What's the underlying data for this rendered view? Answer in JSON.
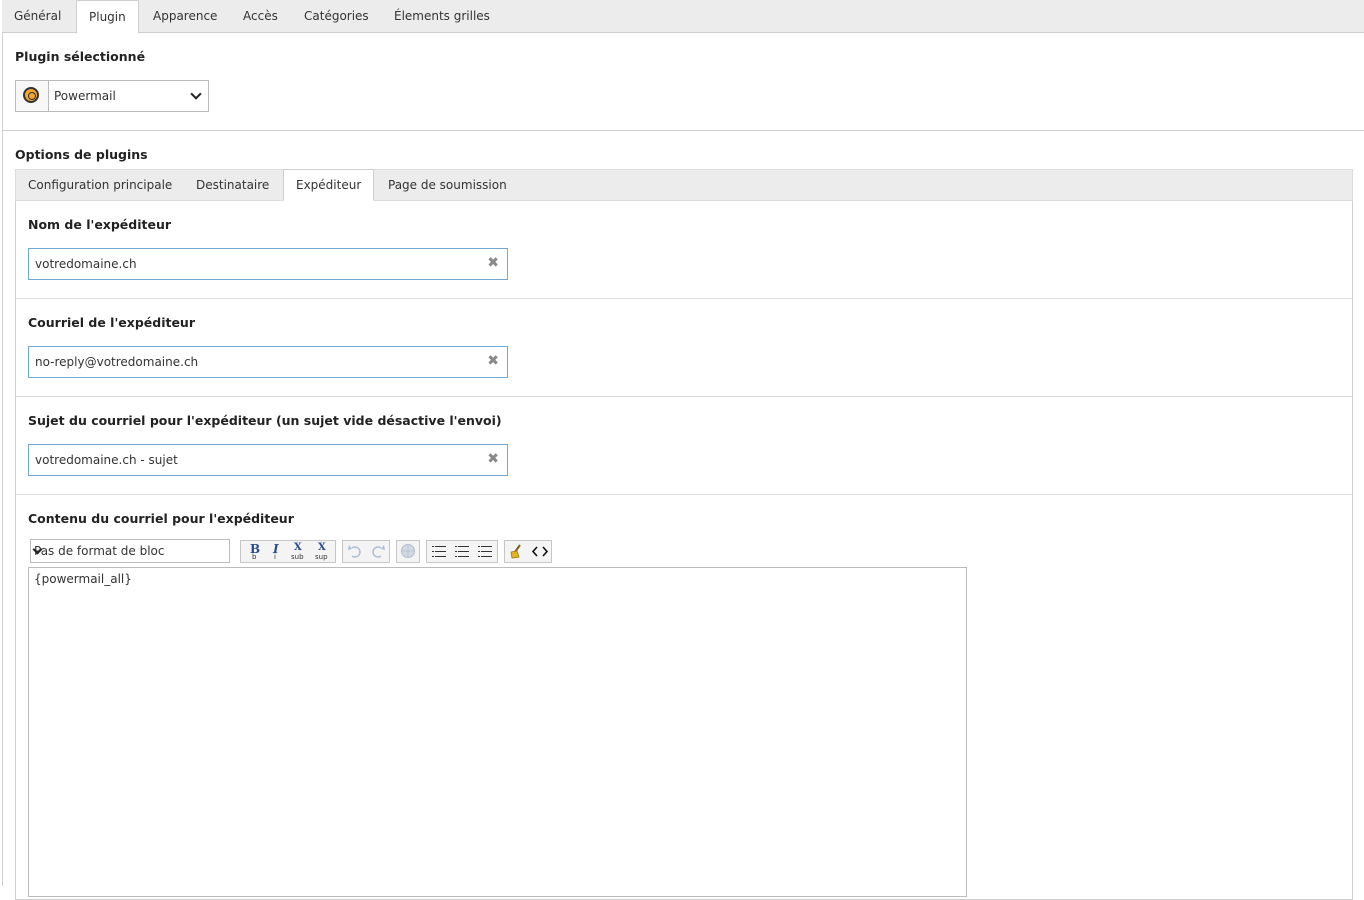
{
  "top_tabs": [
    "Général",
    "Plugin",
    "Apparence",
    "Accès",
    "Catégories",
    "Élements grilles"
  ],
  "active_top_tab": "Plugin",
  "plugin_section": {
    "label": "Plugin sélectionné",
    "selected_plugin": "Powermail",
    "plugin_icon": "powermail-icon"
  },
  "options_section": {
    "label": "Options de plugins",
    "tabs": [
      "Configuration principale",
      "Destinataire",
      "Expéditeur",
      "Page de soumission"
    ],
    "active_tab": "Expéditeur"
  },
  "fields": {
    "sender_name": {
      "label": "Nom de l'expéditeur",
      "value": "votredomaine.ch"
    },
    "sender_email": {
      "label": "Courriel de l'expéditeur",
      "value": "no-reply@votredomaine.ch"
    },
    "sender_subject": {
      "label": "Sujet du courriel pour l'expéditeur (un sujet vide désactive l'envoi)",
      "value": "votredomaine.ch - sujet"
    }
  },
  "body_editor": {
    "label": "Contenu du courriel pour l'expéditeur",
    "block_format": "Pas de format de bloc",
    "content": "{powermail_all}",
    "toolbar": {
      "bold": "B",
      "bold_sub": "b",
      "italic": "I",
      "italic_sub": "i",
      "subscript": "X",
      "subscript_sub": "sub",
      "superscript": "X",
      "superscript_sub": "sup"
    }
  },
  "clear_icon": "✖"
}
